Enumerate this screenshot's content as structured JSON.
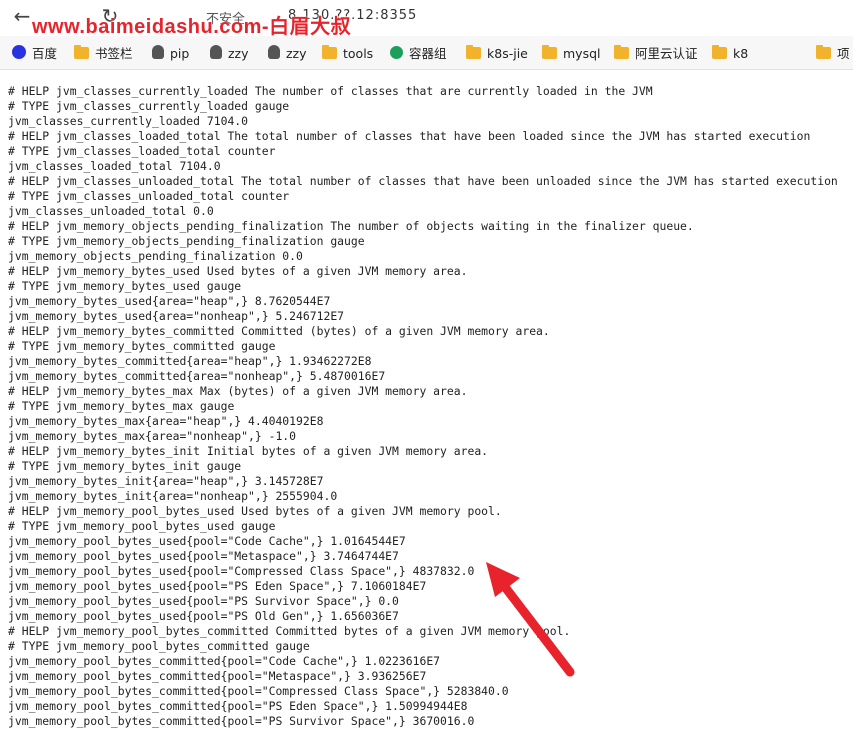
{
  "browser": {
    "insecure_label": "不安全",
    "url": "8.130.??.12:8355",
    "watermark": "www.baimeidashu.com-白眉大叔"
  },
  "bookmarks": [
    {
      "label": "百度",
      "icon": "baidu-icon"
    },
    {
      "label": "书签栏",
      "icon": "folder-icon"
    },
    {
      "label": "pip",
      "icon": "person-icon"
    },
    {
      "label": "zzy",
      "icon": "person-icon"
    },
    {
      "label": "zzy",
      "icon": "person-icon"
    },
    {
      "label": "tools",
      "icon": "folder-icon"
    },
    {
      "label": "容器组",
      "icon": "green-icon"
    },
    {
      "label": "k8s-jie",
      "icon": "folder-icon"
    },
    {
      "label": "mysql",
      "icon": "folder-icon"
    },
    {
      "label": "阿里云认证",
      "icon": "folder-icon"
    },
    {
      "label": "k8",
      "icon": "folder-icon"
    },
    {
      "label": "项",
      "icon": "folder-icon"
    }
  ],
  "metrics_lines": [
    "# HELP jvm_classes_currently_loaded The number of classes that are currently loaded in the JVM",
    "# TYPE jvm_classes_currently_loaded gauge",
    "jvm_classes_currently_loaded 7104.0",
    "# HELP jvm_classes_loaded_total The total number of classes that have been loaded since the JVM has started execution",
    "# TYPE jvm_classes_loaded_total counter",
    "jvm_classes_loaded_total 7104.0",
    "# HELP jvm_classes_unloaded_total The total number of classes that have been unloaded since the JVM has started execution",
    "# TYPE jvm_classes_unloaded_total counter",
    "jvm_classes_unloaded_total 0.0",
    "# HELP jvm_memory_objects_pending_finalization The number of objects waiting in the finalizer queue.",
    "# TYPE jvm_memory_objects_pending_finalization gauge",
    "jvm_memory_objects_pending_finalization 0.0",
    "# HELP jvm_memory_bytes_used Used bytes of a given JVM memory area.",
    "# TYPE jvm_memory_bytes_used gauge",
    "jvm_memory_bytes_used{area=\"heap\",} 8.7620544E7",
    "jvm_memory_bytes_used{area=\"nonheap\",} 5.246712E7",
    "# HELP jvm_memory_bytes_committed Committed (bytes) of a given JVM memory area.",
    "# TYPE jvm_memory_bytes_committed gauge",
    "jvm_memory_bytes_committed{area=\"heap\",} 1.93462272E8",
    "jvm_memory_bytes_committed{area=\"nonheap\",} 5.4870016E7",
    "# HELP jvm_memory_bytes_max Max (bytes) of a given JVM memory area.",
    "# TYPE jvm_memory_bytes_max gauge",
    "jvm_memory_bytes_max{area=\"heap\",} 4.4040192E8",
    "jvm_memory_bytes_max{area=\"nonheap\",} -1.0",
    "# HELP jvm_memory_bytes_init Initial bytes of a given JVM memory area.",
    "# TYPE jvm_memory_bytes_init gauge",
    "jvm_memory_bytes_init{area=\"heap\",} 3.145728E7",
    "jvm_memory_bytes_init{area=\"nonheap\",} 2555904.0",
    "# HELP jvm_memory_pool_bytes_used Used bytes of a given JVM memory pool.",
    "# TYPE jvm_memory_pool_bytes_used gauge",
    "jvm_memory_pool_bytes_used{pool=\"Code Cache\",} 1.0164544E7",
    "jvm_memory_pool_bytes_used{pool=\"Metaspace\",} 3.7464744E7",
    "jvm_memory_pool_bytes_used{pool=\"Compressed Class Space\",} 4837832.0",
    "jvm_memory_pool_bytes_used{pool=\"PS Eden Space\",} 7.1060184E7",
    "jvm_memory_pool_bytes_used{pool=\"PS Survivor Space\",} 0.0",
    "jvm_memory_pool_bytes_used{pool=\"PS Old Gen\",} 1.656036E7",
    "# HELP jvm_memory_pool_bytes_committed Committed bytes of a given JVM memory pool.",
    "# TYPE jvm_memory_pool_bytes_committed gauge",
    "jvm_memory_pool_bytes_committed{pool=\"Code Cache\",} 1.0223616E7",
    "jvm_memory_pool_bytes_committed{pool=\"Metaspace\",} 3.936256E7",
    "jvm_memory_pool_bytes_committed{pool=\"Compressed Class Space\",} 5283840.0",
    "jvm_memory_pool_bytes_committed{pool=\"PS Eden Space\",} 1.50994944E8",
    "jvm_memory_pool_bytes_committed{pool=\"PS Survivor Space\",} 3670016.0"
  ],
  "annotation": {
    "color": "#e8232c",
    "icon": "red-arrow-icon"
  }
}
